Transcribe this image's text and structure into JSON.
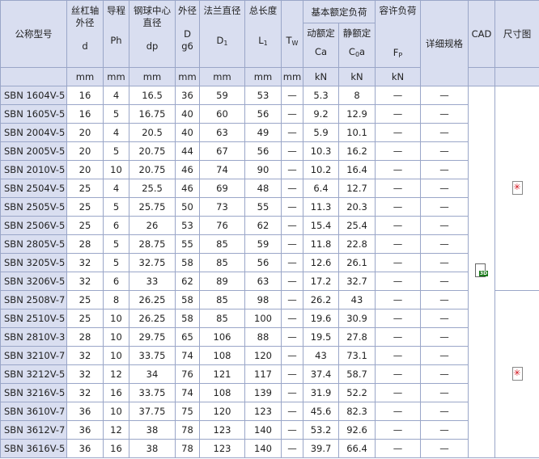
{
  "header": {
    "model": "公称型号",
    "shaft_od": "丝杠轴外径",
    "shaft_od_sym": "d",
    "lead": "导程",
    "lead_sym": "Ph",
    "ball_pcd": "钢球中心直径",
    "ball_pcd_sym": "dp",
    "outer_d": "外径",
    "outer_d_sym": "D",
    "outer_d_tol": "g6",
    "flange": "法兰直径",
    "flange_sym": "D",
    "flange_sub": "1",
    "length": "总长度",
    "length_sym": "L",
    "length_sub": "1",
    "tw_sym": "T",
    "tw_sub": "W",
    "basic_load": "基本额定负荷",
    "dynamic": "动额定",
    "dynamic_sym": "Ca",
    "static": "静额定",
    "static_sym": "C",
    "static_sub": "0",
    "static_tail": "a",
    "allow_load": "容许负荷",
    "allow_sym": "F",
    "allow_sub": "P",
    "detail": "详细规格",
    "cad": "CAD",
    "drawing": "尺寸图"
  },
  "units": [
    "mm",
    "mm",
    "mm",
    "mm",
    "mm",
    "mm",
    "mm",
    "kN",
    "kN",
    "kN"
  ],
  "rows": [
    {
      "model": "SBN 1604V-5",
      "d": "16",
      "ph": "4",
      "dp": "16.5",
      "D": "36",
      "D1": "59",
      "L1": "53",
      "tw": "—",
      "ca": "5.3",
      "c0a": "8",
      "fp": "—",
      "detail": "—"
    },
    {
      "model": "SBN 1605V-5",
      "d": "16",
      "ph": "5",
      "dp": "16.75",
      "D": "40",
      "D1": "60",
      "L1": "56",
      "tw": "—",
      "ca": "9.2",
      "c0a": "12.9",
      "fp": "—",
      "detail": "—"
    },
    {
      "model": "SBN 2004V-5",
      "d": "20",
      "ph": "4",
      "dp": "20.5",
      "D": "40",
      "D1": "63",
      "L1": "49",
      "tw": "—",
      "ca": "5.9",
      "c0a": "10.1",
      "fp": "—",
      "detail": "—"
    },
    {
      "model": "SBN 2005V-5",
      "d": "20",
      "ph": "5",
      "dp": "20.75",
      "D": "44",
      "D1": "67",
      "L1": "56",
      "tw": "—",
      "ca": "10.3",
      "c0a": "16.2",
      "fp": "—",
      "detail": "—"
    },
    {
      "model": "SBN 2010V-5",
      "d": "20",
      "ph": "10",
      "dp": "20.75",
      "D": "46",
      "D1": "74",
      "L1": "90",
      "tw": "—",
      "ca": "10.2",
      "c0a": "16.4",
      "fp": "—",
      "detail": "—"
    },
    {
      "model": "SBN 2504V-5",
      "d": "25",
      "ph": "4",
      "dp": "25.5",
      "D": "46",
      "D1": "69",
      "L1": "48",
      "tw": "—",
      "ca": "6.4",
      "c0a": "12.7",
      "fp": "—",
      "detail": "—"
    },
    {
      "model": "SBN 2505V-5",
      "d": "25",
      "ph": "5",
      "dp": "25.75",
      "D": "50",
      "D1": "73",
      "L1": "55",
      "tw": "—",
      "ca": "11.3",
      "c0a": "20.3",
      "fp": "—",
      "detail": "—"
    },
    {
      "model": "SBN 2506V-5",
      "d": "25",
      "ph": "6",
      "dp": "26",
      "D": "53",
      "D1": "76",
      "L1": "62",
      "tw": "—",
      "ca": "15.4",
      "c0a": "25.4",
      "fp": "—",
      "detail": "—"
    },
    {
      "model": "SBN 2805V-5",
      "d": "28",
      "ph": "5",
      "dp": "28.75",
      "D": "55",
      "D1": "85",
      "L1": "59",
      "tw": "—",
      "ca": "11.8",
      "c0a": "22.8",
      "fp": "—",
      "detail": "—"
    },
    {
      "model": "SBN 3205V-5",
      "d": "32",
      "ph": "5",
      "dp": "32.75",
      "D": "58",
      "D1": "85",
      "L1": "56",
      "tw": "—",
      "ca": "12.6",
      "c0a": "26.1",
      "fp": "—",
      "detail": "—"
    },
    {
      "model": "SBN 3206V-5",
      "d": "32",
      "ph": "6",
      "dp": "33",
      "D": "62",
      "D1": "89",
      "L1": "63",
      "tw": "—",
      "ca": "17.2",
      "c0a": "32.7",
      "fp": "—",
      "detail": "—"
    },
    {
      "model": "SBN 2508V-7",
      "d": "25",
      "ph": "8",
      "dp": "26.25",
      "D": "58",
      "D1": "85",
      "L1": "98",
      "tw": "—",
      "ca": "26.2",
      "c0a": "43",
      "fp": "—",
      "detail": "—"
    },
    {
      "model": "SBN 2510V-5",
      "d": "25",
      "ph": "10",
      "dp": "26.25",
      "D": "58",
      "D1": "85",
      "L1": "100",
      "tw": "—",
      "ca": "19.6",
      "c0a": "30.9",
      "fp": "—",
      "detail": "—"
    },
    {
      "model": "SBN 2810V-3",
      "d": "28",
      "ph": "10",
      "dp": "29.75",
      "D": "65",
      "D1": "106",
      "L1": "88",
      "tw": "—",
      "ca": "19.5",
      "c0a": "27.8",
      "fp": "—",
      "detail": "—"
    },
    {
      "model": "SBN 3210V-7",
      "d": "32",
      "ph": "10",
      "dp": "33.75",
      "D": "74",
      "D1": "108",
      "L1": "120",
      "tw": "—",
      "ca": "43",
      "c0a": "73.1",
      "fp": "—",
      "detail": "—"
    },
    {
      "model": "SBN 3212V-5",
      "d": "32",
      "ph": "12",
      "dp": "34",
      "D": "76",
      "D1": "121",
      "L1": "117",
      "tw": "—",
      "ca": "37.4",
      "c0a": "58.7",
      "fp": "—",
      "detail": "—"
    },
    {
      "model": "SBN 3216V-5",
      "d": "32",
      "ph": "16",
      "dp": "33.75",
      "D": "74",
      "D1": "108",
      "L1": "139",
      "tw": "—",
      "ca": "31.9",
      "c0a": "52.2",
      "fp": "—",
      "detail": "—"
    },
    {
      "model": "SBN 3610V-7",
      "d": "36",
      "ph": "10",
      "dp": "37.75",
      "D": "75",
      "D1": "120",
      "L1": "123",
      "tw": "—",
      "ca": "45.6",
      "c0a": "82.3",
      "fp": "—",
      "detail": "—"
    },
    {
      "model": "SBN 3612V-7",
      "d": "36",
      "ph": "12",
      "dp": "38",
      "D": "78",
      "D1": "123",
      "L1": "140",
      "tw": "—",
      "ca": "53.2",
      "c0a": "92.6",
      "fp": "—",
      "detail": "—"
    },
    {
      "model": "SBN 3616V-5",
      "d": "36",
      "ph": "16",
      "dp": "38",
      "D": "78",
      "D1": "123",
      "L1": "140",
      "tw": "—",
      "ca": "39.7",
      "c0a": "66.4",
      "fp": "—",
      "detail": "—"
    }
  ],
  "icons": {
    "pdf": "pdf-document-icon",
    "cad": "cad-3d-file-icon",
    "pdf_color": "#d0101a",
    "cad_color": "#1a7a1a",
    "cad_tag": "3D"
  }
}
